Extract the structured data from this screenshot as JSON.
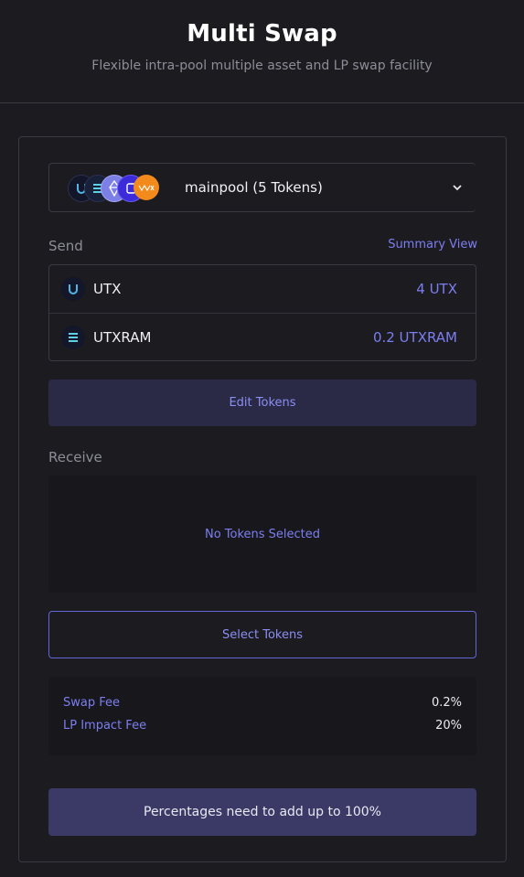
{
  "header": {
    "title": "Multi Swap",
    "subtitle": "Flexible intra-pool multiple asset and LP swap facility"
  },
  "pool": {
    "label": "mainpool (5 Tokens)",
    "icons": [
      "utx-icon",
      "utxram-icon",
      "eos-icon",
      "purple-token-icon",
      "orange-token-icon"
    ]
  },
  "send": {
    "label": "Send",
    "summary_link": "Summary View",
    "tokens": [
      {
        "name": "UTX",
        "amount": "4 UTX",
        "icon": "utx-icon"
      },
      {
        "name": "UTXRAM",
        "amount": "0.2 UTXRAM",
        "icon": "utxram-icon"
      }
    ],
    "edit_button": "Edit Tokens"
  },
  "receive": {
    "label": "Receive",
    "empty_text": "No Tokens Selected",
    "select_button": "Select Tokens"
  },
  "fees": [
    {
      "label": "Swap Fee",
      "value": "0.2%"
    },
    {
      "label": "LP Impact Fee",
      "value": "20%"
    }
  ],
  "submit_button": "Percentages need to add up to 100%",
  "colors": {
    "background": "#1c1b20",
    "accent": "#7c7ef0",
    "button_fill": "#2a2a46",
    "submit_fill": "#3b3a66",
    "border": "#3a3a42"
  }
}
